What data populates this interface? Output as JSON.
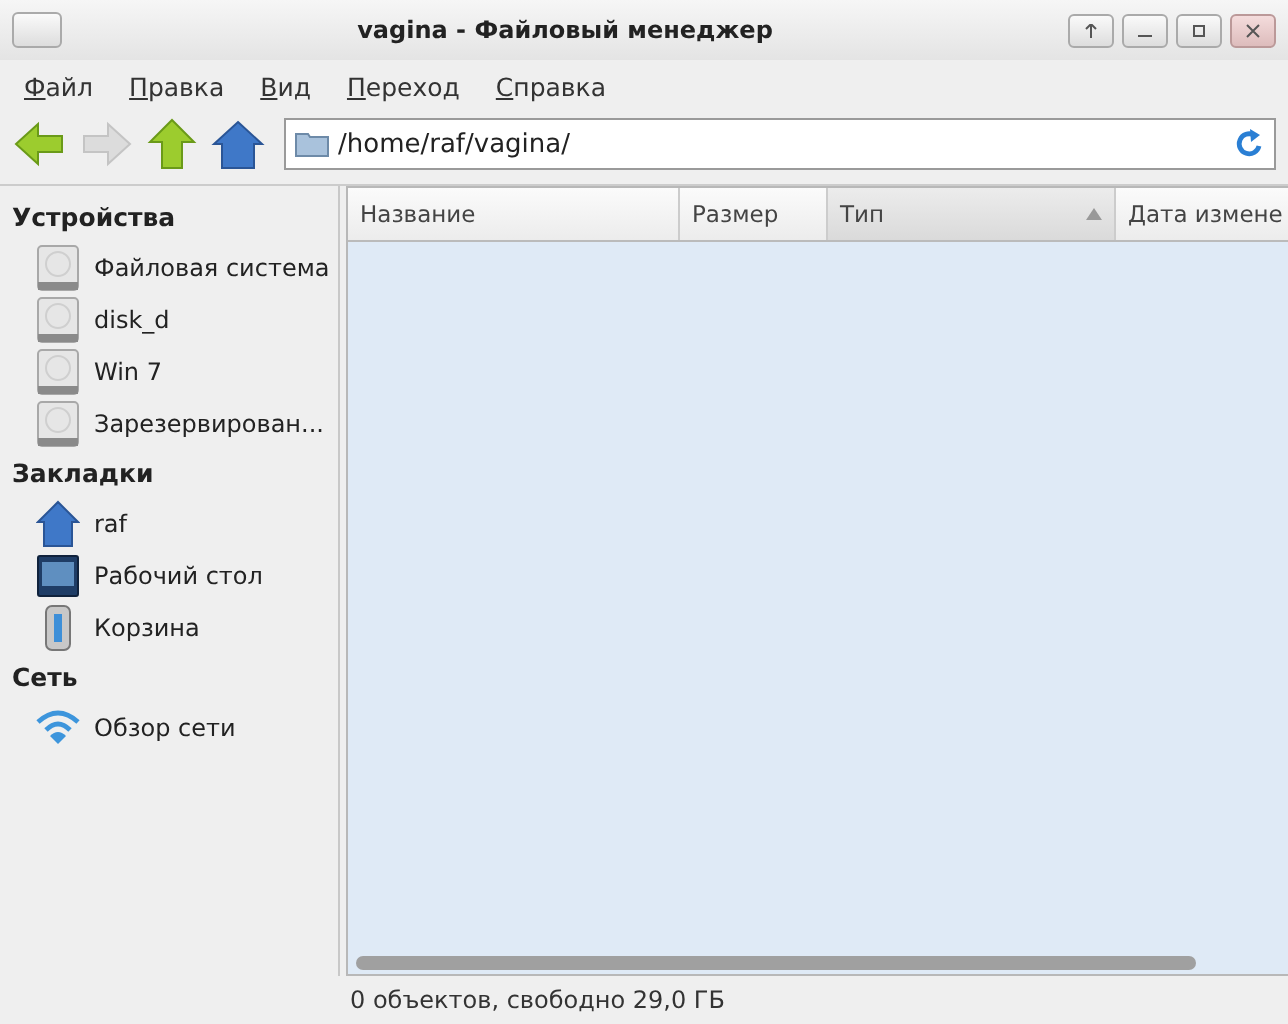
{
  "window": {
    "title": "vagina - Файловый менеджер"
  },
  "menu": [
    {
      "label": "Файл"
    },
    {
      "label": "Правка"
    },
    {
      "label": "Вид"
    },
    {
      "label": "Переход"
    },
    {
      "label": "Справка"
    }
  ],
  "toolbar": {
    "buttons": [
      {
        "kind": "back",
        "disabled": false
      },
      {
        "kind": "forward",
        "disabled": true
      },
      {
        "kind": "up",
        "disabled": false
      },
      {
        "kind": "home",
        "disabled": false
      }
    ],
    "location": "/home/raf/vagina/"
  },
  "sidebar": {
    "sections": [
      {
        "title": "Устройства",
        "items": [
          {
            "label": "Файловая система",
            "kind": "drive"
          },
          {
            "label": "disk_d",
            "kind": "drive"
          },
          {
            "label": "Win 7",
            "kind": "drive"
          },
          {
            "label": "Зарезервирован...",
            "kind": "drive"
          }
        ]
      },
      {
        "title": "Закладки",
        "items": [
          {
            "label": "raf",
            "kind": "home"
          },
          {
            "label": "Рабочий стол",
            "kind": "desktop"
          },
          {
            "label": "Корзина",
            "kind": "trash"
          }
        ]
      },
      {
        "title": "Сеть",
        "items": [
          {
            "label": "Обзор сети",
            "kind": "network"
          }
        ]
      }
    ]
  },
  "table": {
    "columns": [
      {
        "label": "Название",
        "sorted": false
      },
      {
        "label": "Размер",
        "sorted": false
      },
      {
        "label": "Тип",
        "sorted": true
      },
      {
        "label": "Дата измене",
        "sorted": false
      }
    ]
  },
  "status_bar": "0 объектов, свободно 29,0 ГБ"
}
